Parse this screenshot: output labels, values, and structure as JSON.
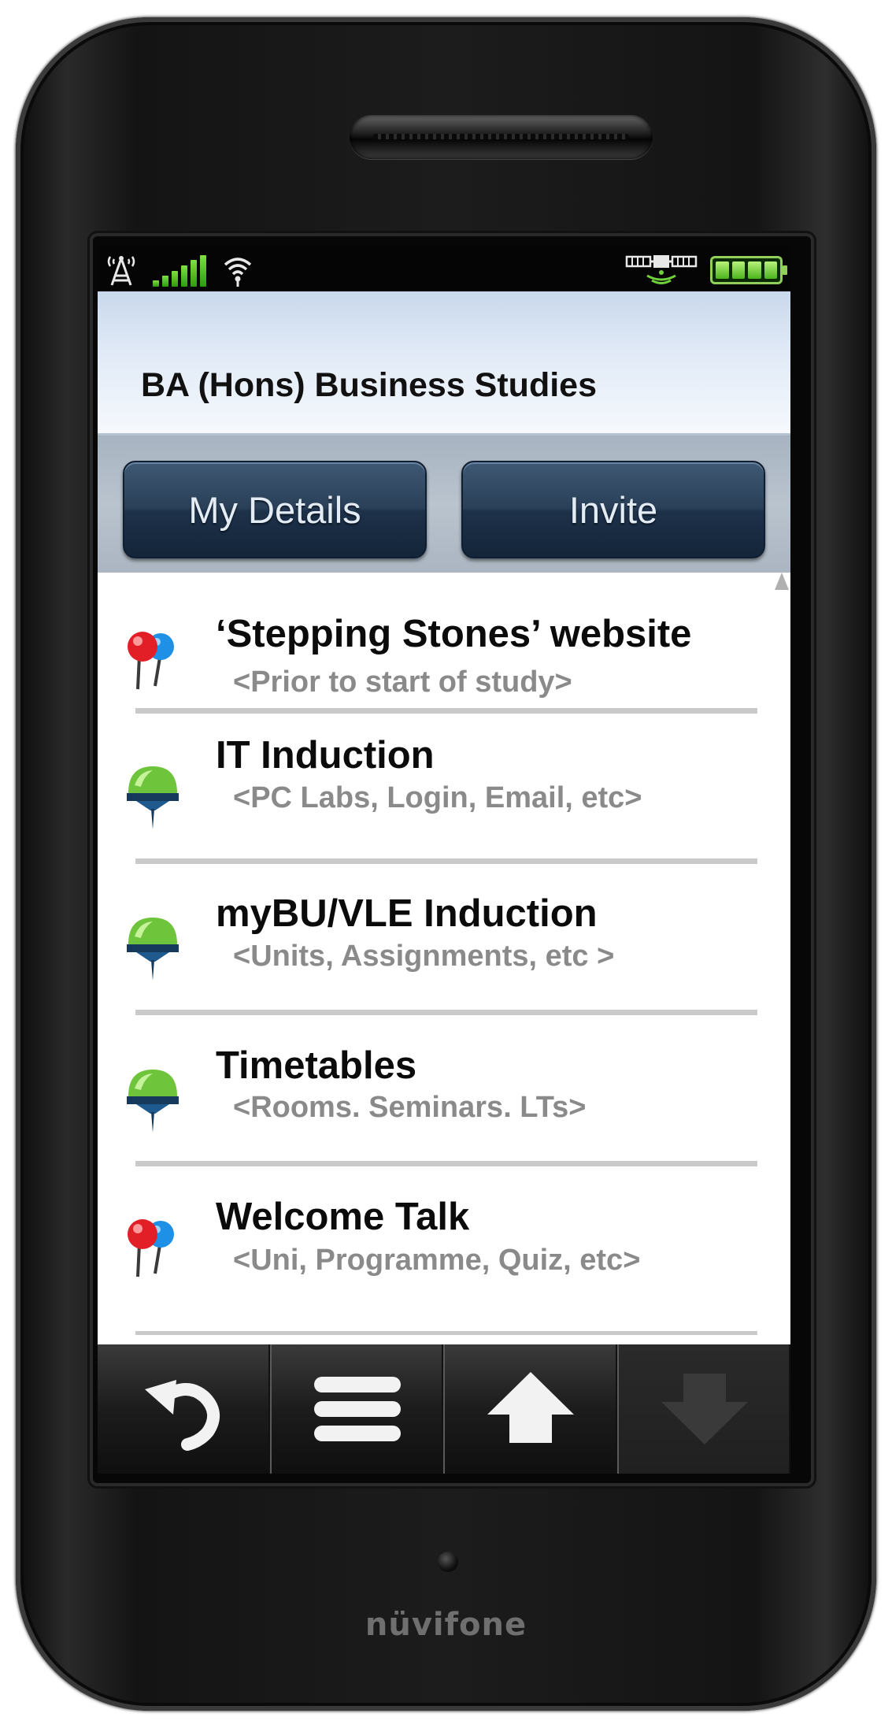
{
  "app": {
    "title": "BA (Hons) Business Studies"
  },
  "status_bar": {
    "icons": [
      "antenna-icon",
      "signal-bars-icon",
      "wifi-icon",
      "satellite-icon",
      "battery-icon"
    ]
  },
  "buttons": {
    "my_details": "My Details",
    "invite": "Invite"
  },
  "list": {
    "items": [
      {
        "title": "‘Stepping Stones’ website",
        "subtitle": "<Prior to start of study>",
        "icon": "red-blue-pins-icon"
      },
      {
        "title": "IT Induction",
        "subtitle": "<PC Labs, Login, Email, etc>",
        "icon": "green-pin-icon"
      },
      {
        "title": "myBU/VLE Induction",
        "subtitle": "<Units, Assignments, etc >",
        "icon": "green-pin-icon"
      },
      {
        "title": "Timetables",
        "subtitle": "<Rooms. Seminars. LTs>",
        "icon": "green-pin-icon"
      },
      {
        "title": "Welcome Talk",
        "subtitle": "<Uni, Programme, Quiz, etc>",
        "icon": "red-blue-pins-icon"
      }
    ]
  },
  "nav": {
    "items": [
      "back-icon",
      "menu-icon",
      "scroll-up-icon",
      "scroll-down-icon"
    ]
  },
  "device": {
    "brand": "nüvifone"
  },
  "colors": {
    "title_bar": "#dfe9f6",
    "button": "#2a4059",
    "button_text": "#e3ebf3",
    "subtitle": "#8a8a8a",
    "signal": "#4cb41d"
  }
}
